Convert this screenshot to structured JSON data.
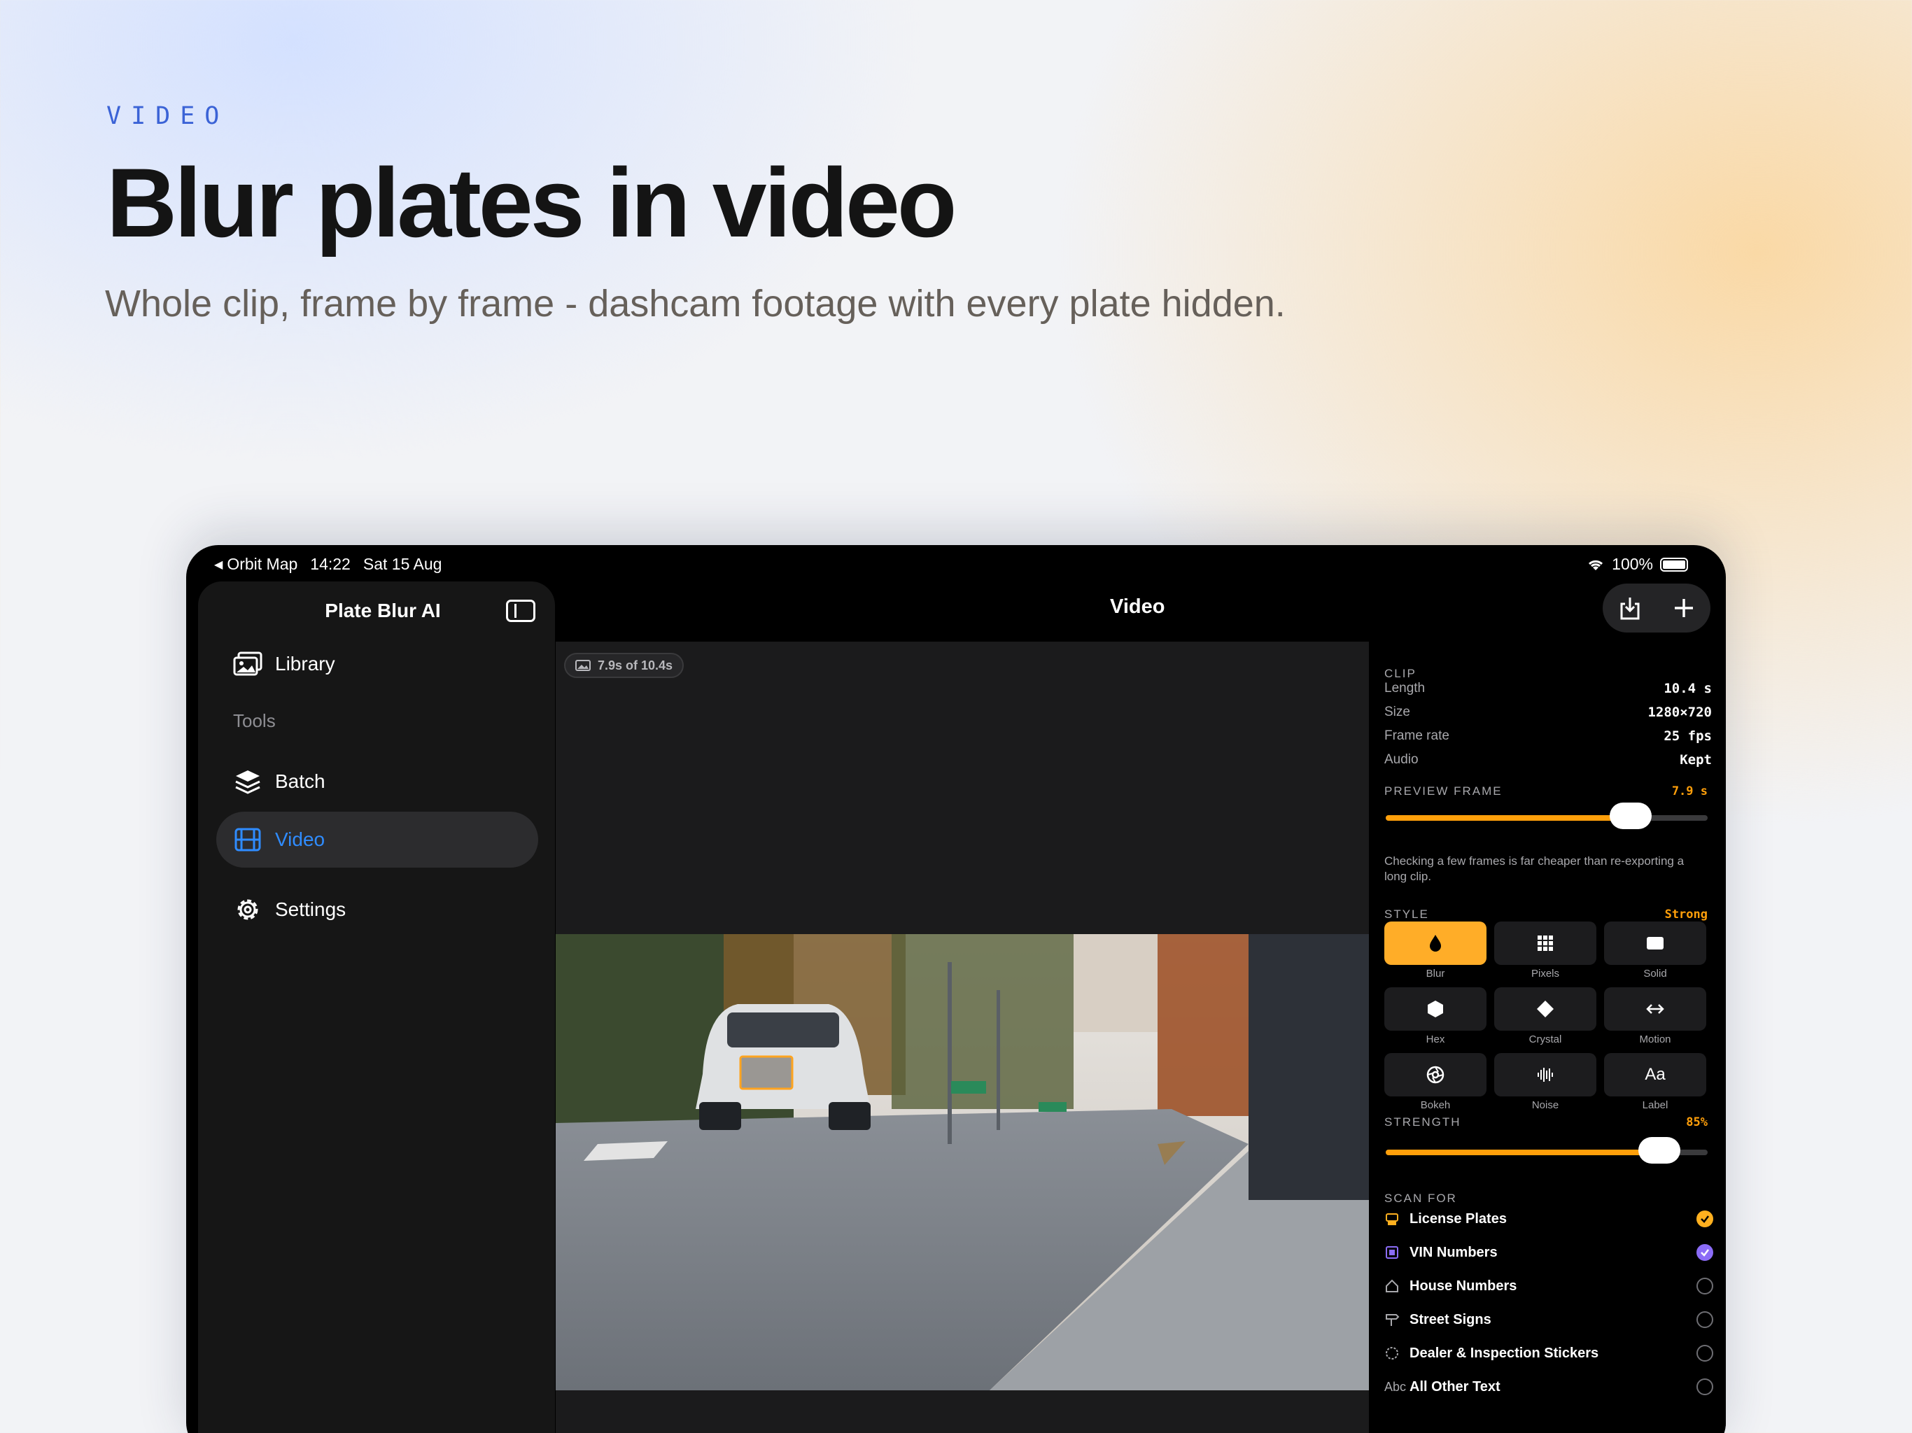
{
  "eyebrow": "VIDEO",
  "headline": "Blur plates in video",
  "subhead": "Whole clip, frame by frame - dashcam footage with every plate hidden.",
  "status": {
    "back_app": "Orbit Map",
    "time": "14:22",
    "date": "Sat 15 Aug",
    "battery": "100%"
  },
  "sidebar": {
    "title": "Plate Blur AI",
    "section_tools": "Tools",
    "items": [
      {
        "label": "Library",
        "icon": "photos-icon"
      },
      {
        "label": "Batch",
        "icon": "layers-icon"
      },
      {
        "label": "Video",
        "icon": "film-icon",
        "active": true
      },
      {
        "label": "Settings",
        "icon": "gear-icon"
      }
    ]
  },
  "nav": {
    "title": "Video"
  },
  "player": {
    "position_chip": "7.9s of 10.4s"
  },
  "inspector": {
    "clip_header": "CLIP",
    "clip": [
      {
        "key": "Length",
        "value": "10.4 s"
      },
      {
        "key": "Size",
        "value": "1280×720"
      },
      {
        "key": "Frame rate",
        "value": "25 fps"
      },
      {
        "key": "Audio",
        "value": "Kept"
      }
    ],
    "preview_header": "PREVIEW FRAME",
    "preview_value": "7.9 s",
    "preview_fraction": 0.76,
    "preview_note": "Checking a few frames is far cheaper than re-exporting a long clip.",
    "style_header": "STYLE",
    "style_value": "Strong",
    "styles": [
      {
        "label": "Blur",
        "icon": "drop-icon",
        "active": true
      },
      {
        "label": "Pixels",
        "icon": "grid-icon"
      },
      {
        "label": "Solid",
        "icon": "rectangle-icon"
      },
      {
        "label": "Hex",
        "icon": "hexagon-icon"
      },
      {
        "label": "Crystal",
        "icon": "diamond-icon"
      },
      {
        "label": "Motion",
        "icon": "arrows-horizontal-icon"
      },
      {
        "label": "Bokeh",
        "icon": "aperture-icon"
      },
      {
        "label": "Noise",
        "icon": "waveform-icon"
      },
      {
        "label": "Label",
        "icon": "text-aa-icon",
        "glyph": "Aa"
      }
    ],
    "strength_header": "STRENGTH",
    "strength_value": "85%",
    "strength_fraction": 0.85,
    "scan_header": "SCAN FOR",
    "scan": [
      {
        "label": "License Plates",
        "icon": "car-plate-icon",
        "checked": true,
        "color": "#ffb01f"
      },
      {
        "label": "VIN Numbers",
        "icon": "vin-icon",
        "checked": true,
        "color": "#8b6cf7"
      },
      {
        "label": "House Numbers",
        "icon": "house-icon",
        "checked": false
      },
      {
        "label": "Street Signs",
        "icon": "signpost-icon",
        "checked": false
      },
      {
        "label": "Dealer & Inspection Stickers",
        "icon": "sticker-icon",
        "checked": false
      },
      {
        "label": "All Other Text",
        "icon": "abc-icon",
        "icon_text": "Abc",
        "checked": false
      }
    ]
  },
  "colors": {
    "accent": "#ff9f0a",
    "active_blue": "#2f8cff",
    "vin_purple": "#8b6cf7"
  }
}
